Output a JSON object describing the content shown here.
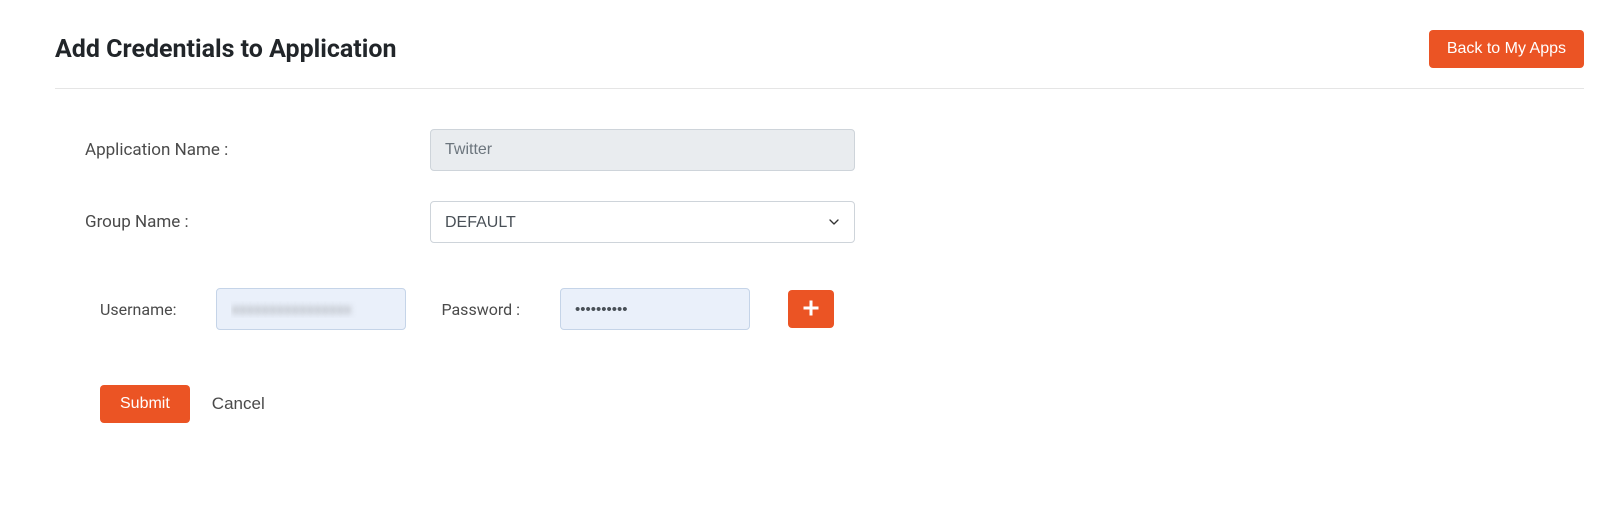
{
  "header": {
    "title": "Add Credentials to Application",
    "back_button": "Back to My Apps"
  },
  "form": {
    "app_name_label": "Application Name :",
    "app_name_value": "Twitter",
    "group_name_label": "Group Name :",
    "group_name_value": "DEFAULT",
    "username_label": "Username:",
    "username_value": "xxxxxxxxxxxxxxxx",
    "password_label": "Password :",
    "password_value": "••••••••••"
  },
  "actions": {
    "submit": "Submit",
    "cancel": "Cancel"
  }
}
